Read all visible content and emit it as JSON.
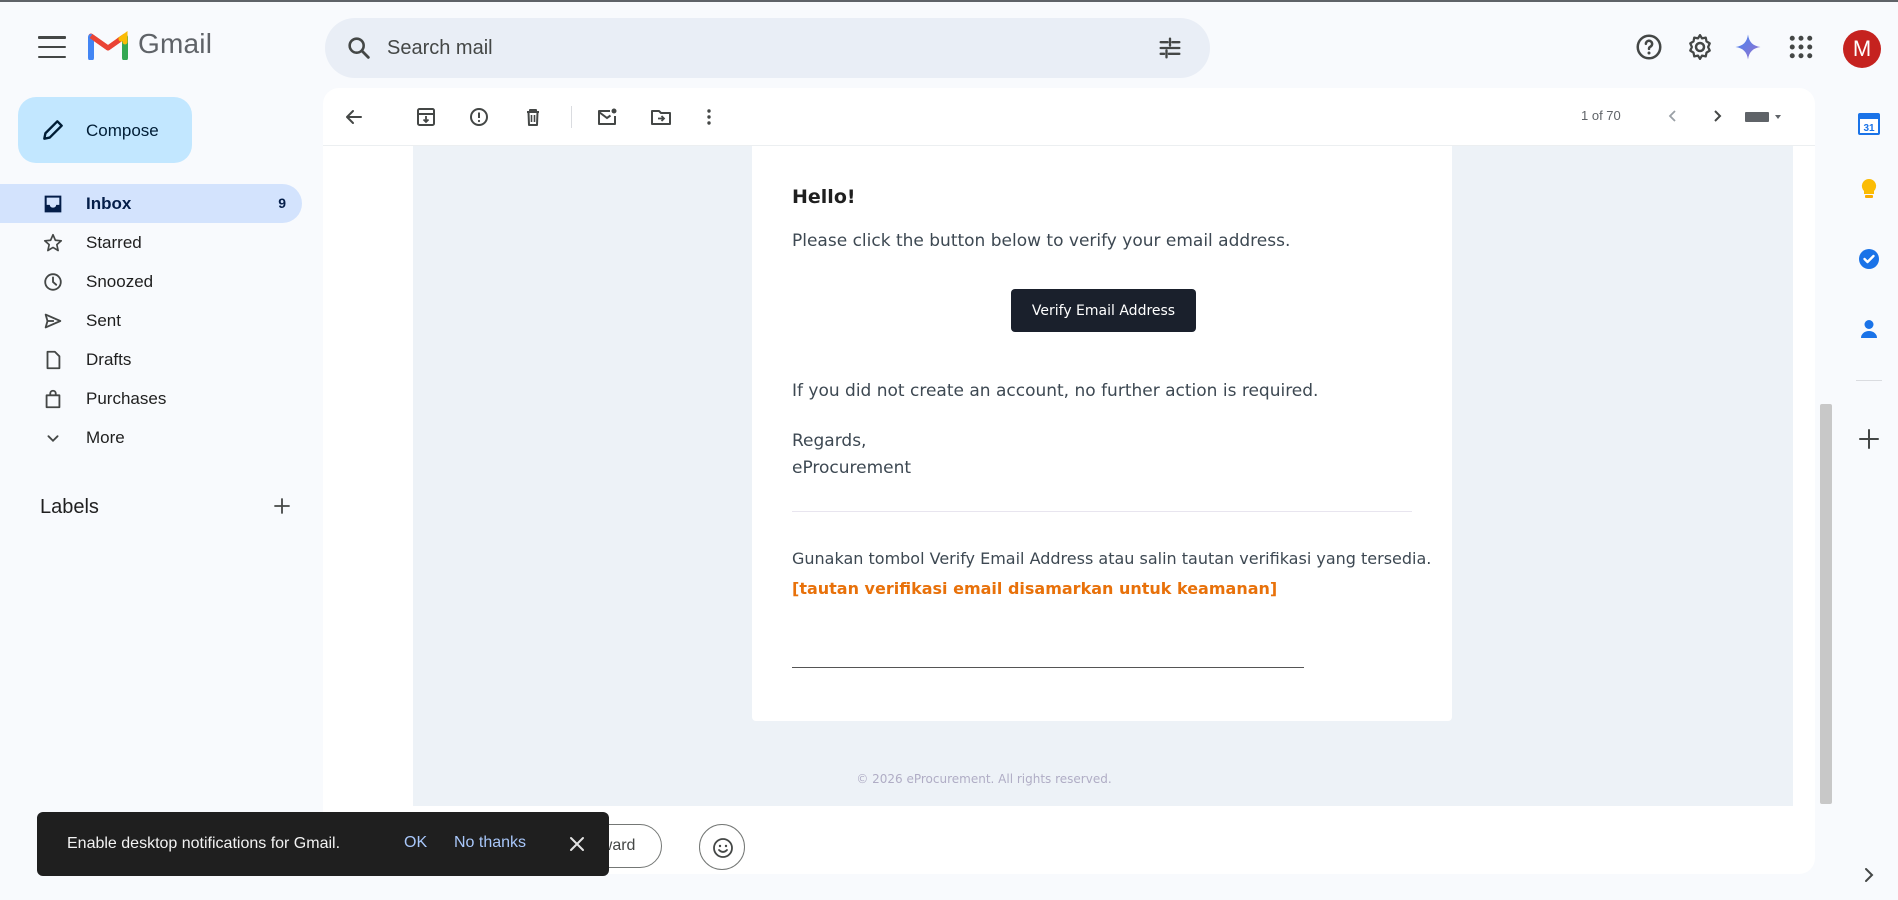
{
  "app": {
    "name": "Gmail"
  },
  "search": {
    "placeholder": "Search mail"
  },
  "header": {
    "avatar_letter": "M"
  },
  "sidebar": {
    "compose_label": "Compose",
    "items": [
      {
        "label": "Inbox",
        "count": "9",
        "icon": "inbox-icon",
        "active": true
      },
      {
        "label": "Starred",
        "count": "",
        "icon": "star-icon"
      },
      {
        "label": "Snoozed",
        "count": "",
        "icon": "clock-icon"
      },
      {
        "label": "Sent",
        "count": "",
        "icon": "send-icon"
      },
      {
        "label": "Drafts",
        "count": "",
        "icon": "draft-icon"
      },
      {
        "label": "Purchases",
        "count": "",
        "icon": "bag-icon"
      },
      {
        "label": "More",
        "count": "",
        "icon": "chevron-down-icon"
      }
    ],
    "labels_title": "Labels"
  },
  "toolbar": {
    "pager": "1 of 70"
  },
  "email": {
    "greeting": "Hello!",
    "line1": "Please click the button below to verify your email address.",
    "button_label": "Verify Email Address",
    "line2": "If you did not create an account, no further action is required.",
    "regards": "Regards,",
    "signature": "eProcurement",
    "subcopy": "Gunakan tombol Verify Email Address atau salin tautan verifikasi yang tersedia.",
    "masked_link": "[tautan verifikasi email disamarkan untuk keamanan]",
    "footer": "© 2026 eProcurement. All rights reserved."
  },
  "reply": {
    "forward_label": "orward"
  },
  "snackbar": {
    "text": "Enable desktop notifications for Gmail.",
    "ok_label": "OK",
    "no_label": "No thanks"
  },
  "rail": {
    "calendar_day": "31"
  },
  "colors": {
    "accent": "#0b57d0",
    "compose_bg": "#c2e7ff",
    "inbox_active": "#d3e3fd",
    "link_orange": "#e8710a",
    "avatar_bg": "#c5221f"
  }
}
